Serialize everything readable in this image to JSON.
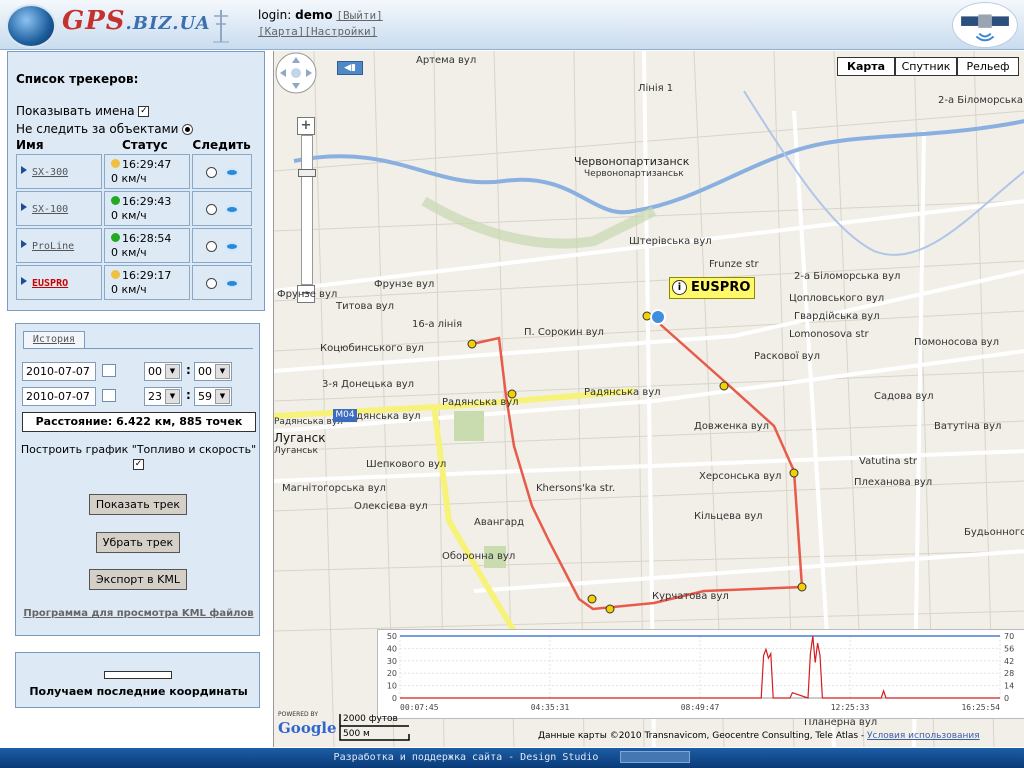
{
  "header": {
    "logo_main": "GPS",
    "logo_domain": ".BIZ.UA",
    "login_label": "login:",
    "login_user": "demo",
    "logout_link": "[Выйти]",
    "map_link": "[Карта]",
    "settings_link": "[Настройки]"
  },
  "trackers": {
    "title": "Список трекеров:",
    "show_names_label": "Показывать имена",
    "show_names_checked": true,
    "no_follow_label": "Не следить за объектами",
    "columns": [
      "Имя",
      "Статус",
      "Следить"
    ],
    "rows": [
      {
        "name": "SX-300",
        "time": "16:29:47",
        "speed": "0 км/ч",
        "status_color": "#f0c040",
        "active": false
      },
      {
        "name": "SX-100",
        "time": "16:29:43",
        "speed": "0 км/ч",
        "status_color": "#22aa22",
        "active": false
      },
      {
        "name": "ProLine",
        "time": "16:28:54",
        "speed": "0 км/ч",
        "status_color": "#22aa22",
        "active": false
      },
      {
        "name": "EUSPRO",
        "time": "16:29:17",
        "speed": "0 км/ч",
        "status_color": "#f0c040",
        "active": true
      }
    ]
  },
  "history": {
    "tab_label": "История",
    "date_from": "2010-07-07",
    "hour_from": "00",
    "minute_from": "00",
    "date_to": "2010-07-07",
    "hour_to": "23",
    "minute_to": "59",
    "distance": "Расстояние: 6.422 км, 885 точек",
    "chart_label": "Построить график \"Топливо и скорость\"",
    "chart_checked": true,
    "show_track_button": "Показать трек",
    "remove_track_button": "Убрать трек",
    "export_kml_button": "Экспорт в KML",
    "kml_link": "Программа для просмотра KML файлов"
  },
  "status": {
    "text": "Получаем последние координаты"
  },
  "map": {
    "types": [
      "Карта",
      "Спутник",
      "Рельеф"
    ],
    "selected_type": "Карта",
    "tracker_label": "EUSPRO",
    "road_badge": "M04",
    "labels": {
      "chervonopartizansk": "Червонопартизанск",
      "chervonopartizansk_small": "Червонопартизанськ",
      "lugansk": "Луганск",
      "lugansk_small": "Луганськ",
      "avangard": "Авангард",
      "frunze": "Frunze str",
      "frunze_vul": "Фрунзе вул",
      "frunzevul2": "Фрунзе вул",
      "radyanska": "Радянська вул",
      "radyanska2": "Радянська вул",
      "radyanska3": "Радянська вул",
      "radyanska4": "Радянська вул",
      "khersonska": "Херсонська вул",
      "khersons_str": "Khersons'ka str.",
      "vatutina": "Vatutina str",
      "vatutina_vul": "Ватутіна вул",
      "lomonosova": "Lomonosova str",
      "pomonosova": "Помоносова вул",
      "kurchatova": "Курчатова вул",
      "sorokyi": "П. Сорокин вул",
      "kotsubinskogo": "Коцюбинського вул",
      "doneckaya": "3-я Донецька вул",
      "liniya16": "16-а лінія",
      "titova": "Титова вул",
      "shepkovogo": "Шепкового вул",
      "magnitogorska": "Магнітогорська вул",
      "oleksieva": "Олексієва вул",
      "oboronna": "Оборонна вул",
      "artema": "Артема вул",
      "bilomorska": "2-а Біломорська вул",
      "shtepivska": "Штерівська вул",
      "tsoplovskogo": "Цопловського вул",
      "gvardiyska": "Гвардійська вул",
      "kiltseva": "Кільцева вул",
      "raskovoi": "Раскової вул",
      "budyonnogo": "Будьонного вул",
      "plekhanova": "Плеханова вул",
      "planerna": "Планерна вул",
      "bilomorska2": "2-а Біломорська вул",
      "sadova": "Садова вул",
      "dovzhenka": "Довженка вул",
      "liniya1": "Лінія 1"
    },
    "scale_ft": "2000 футов",
    "scale_m": "500 м",
    "google_powered": "POWERED BY",
    "google_logo": "Google",
    "copyright": "Данные карты ©2010 Transnavicom, Geocentre Consulting, Tele Atlas -",
    "terms_link": "Условия использования"
  },
  "chart_data": {
    "type": "line",
    "title": "",
    "xlabel": "",
    "ylabel": "",
    "x_ticks": [
      "00:07:45",
      "04:35:31",
      "08:49:47",
      "12:25:33",
      "16:25:54"
    ],
    "y_left_ticks": [
      0,
      10,
      20,
      30,
      40,
      50
    ],
    "y_right_ticks": [
      0,
      14,
      28,
      42,
      56,
      70
    ],
    "ylim_left": [
      0,
      50
    ],
    "ylim_right": [
      0,
      70
    ],
    "grid": true,
    "series": [
      {
        "color": "#4a7fd0",
        "axis": "left",
        "x": [
          0,
          100
        ],
        "y": [
          50,
          50
        ]
      },
      {
        "color": "#d61c1c",
        "axis": "right",
        "x": [
          0,
          60.2,
          60.6,
          61.0,
          61.4,
          61.8,
          62.2,
          65.0,
          65.4,
          68.0,
          68.4,
          68.8,
          69.2,
          69.6,
          70.0,
          70.4,
          80.2,
          80.6,
          81.0,
          100
        ],
        "y": [
          0,
          0,
          48,
          55,
          45,
          50,
          0,
          0,
          6,
          0,
          50,
          70,
          40,
          62,
          48,
          0,
          0,
          8,
          0,
          0
        ]
      }
    ]
  },
  "footer": {
    "text": "Разработка и поддержка сайта - Design Studio"
  }
}
